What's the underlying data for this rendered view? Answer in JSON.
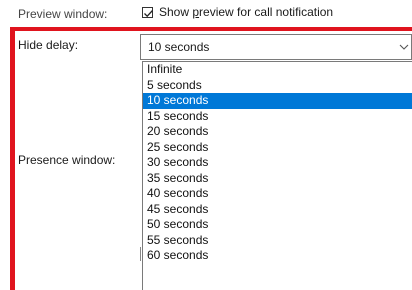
{
  "preview": {
    "label": "Preview window:",
    "checkbox_label_prefix": "Show ",
    "checkbox_label_accel": "p",
    "checkbox_label_suffix": "review for call notification",
    "checked": true
  },
  "hide_delay": {
    "label": "Hide delay:",
    "value": "10 seconds",
    "options": [
      "Infinite",
      "5 seconds",
      "10 seconds",
      "15 seconds",
      "20 seconds",
      "25 seconds",
      "30 seconds",
      "35 seconds",
      "40 seconds",
      "45 seconds",
      "50 seconds",
      "55 seconds",
      "60 seconds"
    ],
    "selected_index": 2
  },
  "presence": {
    "label": "Presence window:"
  },
  "colors": {
    "highlight": "#0078d7",
    "annotation_frame": "#e0141e"
  }
}
